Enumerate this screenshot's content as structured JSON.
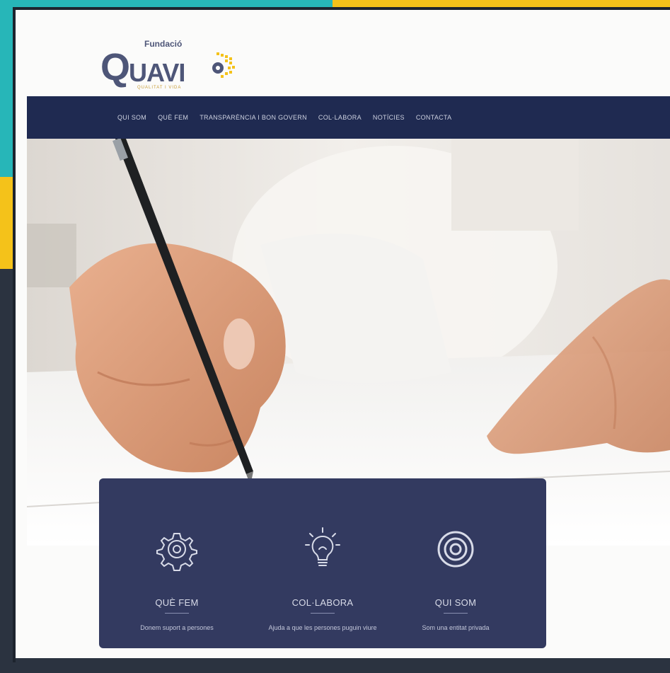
{
  "logo": {
    "tag": "Fundació",
    "initial": "Q",
    "name": "UAVI",
    "subtitle": "QUALITAT I VIDA"
  },
  "nav": {
    "items": [
      "QUI SOM",
      "QUÈ FEM",
      "TRANSPARÈNCIA I BON GOVERN",
      "COL·LABORA",
      "NOTÍCIES",
      "CONTACTA"
    ]
  },
  "features": [
    {
      "icon": "gear-icon",
      "title": "QUÈ FEM",
      "desc": "Donem suport a persones"
    },
    {
      "icon": "lightbulb-icon",
      "title": "COL·LABORA",
      "desc": "Ajuda a que les persones puguin viure"
    },
    {
      "icon": "circle-target-icon",
      "title": "QUI SOM",
      "desc": "Som una entitat privada"
    }
  ],
  "colors": {
    "nav_bg": "#1f2a51",
    "card_bg": "#333a60",
    "logo_blue": "#4e5678",
    "logo_gold": "#f4c21a"
  }
}
